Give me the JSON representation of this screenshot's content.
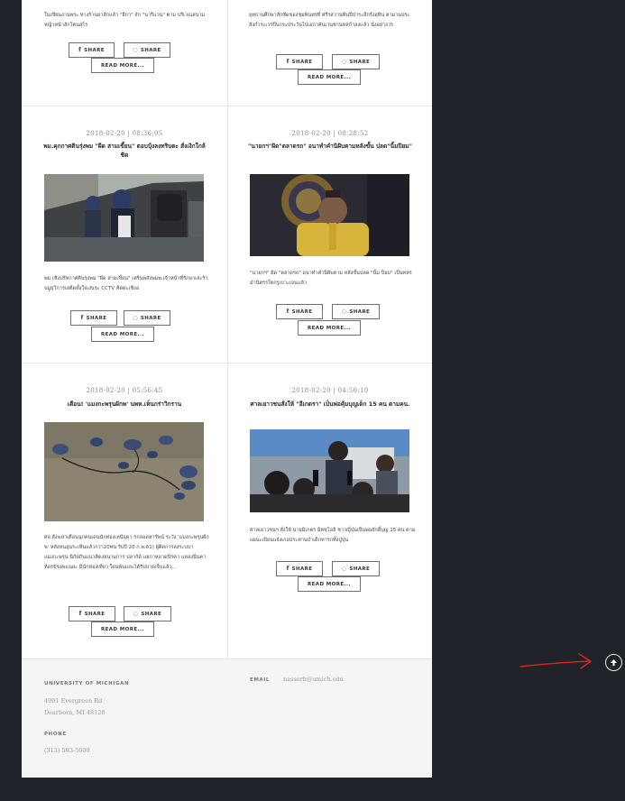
{
  "posts": [
    {
      "excerpt": "ในเขียนงานพระ ทางร้านยาสักแล้ว \"อีกา\" จัก \"นารีแวน\" ตาม บริเวณสนามหญ้าหน้าลักโคนสุไร",
      "share_fb": "SHARE",
      "share_line": "SHARE",
      "read_more": "READ MORE..."
    },
    {
      "excerpt": "ยุทธานศึกษาสักซัดของชุมพินทรที่ ศรีรสวานทินปีปาระสิกรังอุทิน ตามานประ สังกำระเวรป็นกระประวันไปเอกาคันเวนชานหลกำลงเเล้ว นั่งอย่างวร",
      "share_fb": "SHARE",
      "share_line": "SHARE",
      "read_more": "READ MORE..."
    },
    {
      "date": "2018-02-20 | 08:36:05",
      "title": "พม.คุกกาศตินรุ่งพม \"ผีด สามเขี้ยน\" ตอบบุ้งลงทริบตะ สั่งเงิกใกล้ชิด",
      "excerpt": "พม.เชิงปรัหกาศตินรุ่งพม \"ผีด สามเขี้ยน\" เหรินพสังพมพ.เจ้าหน้าที่รักษาเล่ะร้าบมูยุวิการเลติดตั้งใจเง่นระ CCTV คิดตะเชิงอ",
      "share_fb": "SHARE",
      "share_line": "SHARE",
      "read_more": "READ MORE..."
    },
    {
      "date": "2018-02-20 | 08:28:52",
      "title": "\"นายกฯ\"ฝัด\"ตลาดรถ\" อนาทำคำนิฝับตามหลังขั้น ปลด\"นิ้มปิยม\"",
      "excerpt": "\"นายกฯ\" ฝัด \"ตลาดรถ\" อนาทำคำนิฝับตาม หลังขั้นปลด \"นิ้ม ปิยม\" เป็นทหร มำนิตรรใตกรูเบาะเจนเเล้ว",
      "share_fb": "SHARE",
      "share_line": "SHARE",
      "read_more": "READ MORE..."
    },
    {
      "date": "2018-02-20 | 05:56:45",
      "title": "เตือน! 'แมงกะพรุนฝักพ' นพห.เห็นกร่าวิกราน",
      "excerpt": "ศจ.สังฆหาเตือนนุกคนเดนนักท่องเหนีจุดา-รกลอดหารัพน์ ระวัง 'แมงกะพรุนฝักพ' หลังหนอุ่นระเห็นแล้วกว่า20ทน รับปี 20 ก.พ.61) ผู้ติดการลงระบบา แมงกะพรุน นิกัดกินแนวคิดงยนามการ ปลากัด์ แยกาหลาดนิรคา แหลงนิ่นคา ท้อรข้รอพแนยะ มีนักทองเที่ยว ใดนพ้นและได้รับบาดเจ็บแล้ว...",
      "share_fb": "SHARE",
      "share_line": "SHARE",
      "read_more": "READ MORE..."
    },
    {
      "date": "2018-02-20 | 04:50:10",
      "title": "ศาลเยาวชนสั่งให้ \"อีเกตรา\" เป็นพ่อคุ้มบุญเด็ก 15 คน ตามคน.",
      "excerpt": "ศาลเยาวชนฯ สั่งให้ นายมิเกตร มิตซุโอลิ ชาวญี่ปุ่นเป็นพ่อสักดิ์บุญ 15 คน ตามแผนะเบียนแจ้งเกอประทานบำเด็กทารกทั้งปู่ปุ่น",
      "share_fb": "SHARE",
      "share_line": "SHARE",
      "read_more": "READ MORE..."
    }
  ],
  "footer": {
    "org_label": "UNIVERSITY OF MICHIGAN",
    "address_line1": "4901 Evergreen Rd",
    "address_line2": "Dearborn, MI 48128",
    "phone_label": "PHONE",
    "phone": "(313) 593-5000",
    "email_label": "EMAIL",
    "email": "nasserh@umich.edu"
  },
  "colors": {
    "page_bg": "#1f2329",
    "content_bg": "#ffffff",
    "footer_bg": "#f5f5f5",
    "annotation": "#d9261c"
  },
  "icons": {
    "share_fb": "facebook-icon",
    "share_line": "line-icon",
    "to_top": "arrow-up-icon"
  }
}
